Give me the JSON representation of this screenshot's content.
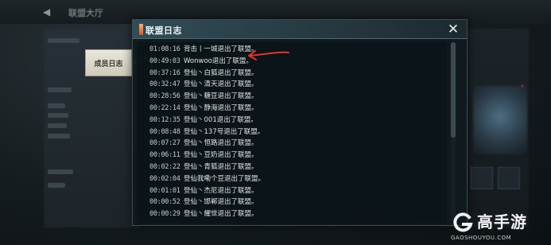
{
  "background": {
    "back_icon": "back-arrow-icon",
    "window_title": "联盟大厅"
  },
  "side_tab": {
    "label": "成员日志",
    "selected": true
  },
  "dialog": {
    "title": "联盟日志",
    "close_icon": "close-icon",
    "entries": [
      {
        "time": "01:08:16",
        "text": "背击丨一城退出了联盟。"
      },
      {
        "time": "00:49:03",
        "text": "Wonwoo退出了联盟。"
      },
      {
        "time": "00:37:16",
        "text": "登仙丶白狐退出了联盟。"
      },
      {
        "time": "00:32:47",
        "text": "登仙丶清天退出了联盟。"
      },
      {
        "time": "00:28:56",
        "text": "登仙丶糖豆退出了联盟。"
      },
      {
        "time": "00:22:14",
        "text": "登仙丶静海退出了联盟。"
      },
      {
        "time": "00:12:35",
        "text": "登仙丶001退出了联盟。"
      },
      {
        "time": "00:08:48",
        "text": "登仙丶137号退出了联盟。"
      },
      {
        "time": "00:07:27",
        "text": "登仙丶恒路退出了联盟。"
      },
      {
        "time": "00:06:11",
        "text": "登仙丶豆奶退出了联盟。"
      },
      {
        "time": "00:02:22",
        "text": "登仙丶青狐退出了联盟。"
      },
      {
        "time": "00:02:04",
        "text": "登仙我嘞个豆退出了联盟。"
      },
      {
        "time": "00:01:01",
        "text": "登仙丶杰尼退出了联盟。"
      },
      {
        "time": "00:00:52",
        "text": "登仙丶邯郸退出了联盟。"
      },
      {
        "time": "00:00:29",
        "text": "登仙丶耀世退出了联盟。"
      }
    ]
  },
  "annotation": {
    "arrow_color": "#e0352b",
    "points_to_entry": 1
  },
  "watermark": {
    "brand": "高手游",
    "url": "GAOSHOUYOU.COM",
    "logo_icon": "g-logo-icon"
  },
  "colors": {
    "header_accent": "#314d57",
    "title_marker": "#e07a3a",
    "tab_bg": "#e3dfd3"
  }
}
